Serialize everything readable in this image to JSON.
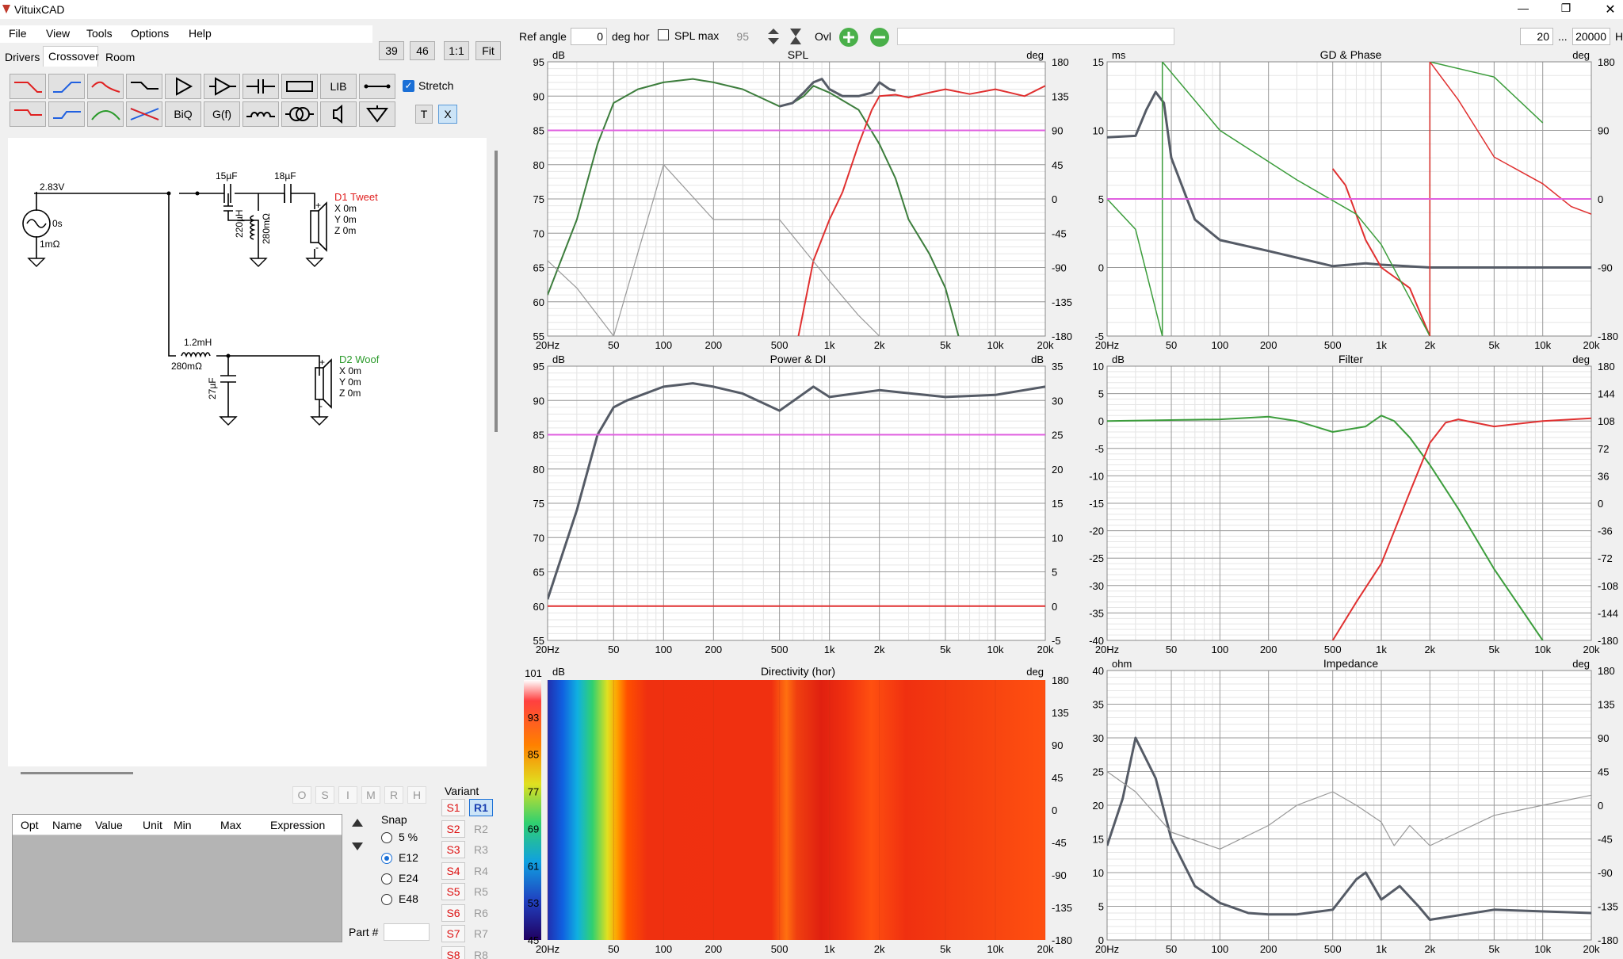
{
  "app": {
    "title": "VituixCAD",
    "win_min": "—",
    "win_max": "❐",
    "win_close": "✕"
  },
  "menu": [
    "File",
    "View",
    "Tools",
    "Options",
    "Help"
  ],
  "tabs": [
    "Drivers",
    "Crossover",
    "Room"
  ],
  "zoom": {
    "z39": "39",
    "z46": "46",
    "z11": "1:1",
    "fit": "Fit"
  },
  "toolbar": {
    "lib": "LIB",
    "biq": "BiQ",
    "gf": "G(f)",
    "stretch": "Stretch",
    "t": "T",
    "x": "X"
  },
  "top": {
    "ref_angle_label": "Ref angle",
    "ref_angle": "0",
    "deg_hor": "deg hor",
    "spl_max_label": "SPL max",
    "spl_max": "95",
    "ovl": "Ovl",
    "f_min": "20",
    "ellipsis": "...",
    "f_max": "20000",
    "h": "H"
  },
  "schematic": {
    "v": "2.83V",
    "s": "0s",
    "r": "1mΩ",
    "c1": "15µF",
    "c2": "18µF",
    "l1": "220µH",
    "r1": "280mΩ",
    "d1": "D1 Tweet",
    "d1x": "X 0m",
    "d1y": "Y 0m",
    "d1z": "Z 0m",
    "l2": "1.2mH",
    "r2": "280mΩ",
    "c3": "27µF",
    "d2": "D2 Woof",
    "d2x": "X 0m",
    "d2y": "Y 0m",
    "d2z": "Z 0m",
    "plus": "+",
    "minus": "-"
  },
  "opt": {
    "letters": [
      "O",
      "S",
      "I",
      "M",
      "R",
      "H"
    ],
    "columns": [
      "Opt",
      "Name",
      "Value",
      "Unit",
      "Min",
      "Max",
      "Expression"
    ]
  },
  "snap": {
    "label": "Snap",
    "options": [
      "5 %",
      "E12",
      "E24",
      "E48"
    ],
    "selected": "E12",
    "part_label": "Part #"
  },
  "variant": {
    "label": "Variant",
    "s": [
      "S1",
      "S2",
      "S3",
      "S4",
      "S5",
      "S6",
      "S7",
      "S8"
    ],
    "r": [
      "R1",
      "R2",
      "R3",
      "R4",
      "R5",
      "R6",
      "R7",
      "R8"
    ]
  },
  "freq_ticks": [
    "20Hz",
    "50",
    "100",
    "200",
    "500",
    "1k",
    "2k",
    "5k",
    "10k",
    "20k"
  ],
  "charts": {
    "spl": {
      "title": "SPL",
      "left_unit": "dB",
      "right_unit": "deg",
      "left": [
        "95",
        "90",
        "85",
        "80",
        "75",
        "70",
        "65",
        "60",
        "55"
      ],
      "right": [
        "180",
        "135",
        "90",
        "45",
        "0",
        "-45",
        "-90",
        "-135",
        "-180"
      ]
    },
    "gd": {
      "title": "GD & Phase",
      "left_unit": "ms",
      "right_unit": "deg",
      "left": [
        "15",
        "10",
        "5",
        "0",
        "-5"
      ],
      "right": [
        "180",
        "90",
        "0",
        "-90",
        "-180"
      ]
    },
    "power": {
      "title": "Power & DI",
      "left_unit": "dB",
      "right_unit": "dB",
      "left": [
        "95",
        "90",
        "85",
        "80",
        "75",
        "70",
        "65",
        "60",
        "55"
      ],
      "right": [
        "35",
        "30",
        "25",
        "20",
        "15",
        "10",
        "5",
        "0",
        "-5"
      ]
    },
    "filter": {
      "title": "Filter",
      "left_unit": "dB",
      "right_unit": "deg",
      "left": [
        "10",
        "5",
        "0",
        "-5",
        "-10",
        "-15",
        "-20",
        "-25",
        "-30",
        "-35",
        "-40"
      ],
      "right": [
        "180",
        "144",
        "108",
        "72",
        "36",
        "0",
        "-36",
        "-72",
        "-108",
        "-144",
        "-180"
      ]
    },
    "dir": {
      "title": "Directivity (hor)",
      "left_unit": "dB",
      "right_unit": "deg",
      "scale": [
        "101",
        "93",
        "85",
        "77",
        "69",
        "61",
        "53",
        "45"
      ],
      "right": [
        "180",
        "135",
        "90",
        "45",
        "0",
        "-45",
        "-90",
        "-135",
        "-180"
      ]
    },
    "imp": {
      "title": "Impedance",
      "left_unit": "ohm",
      "right_unit": "deg",
      "left": [
        "40",
        "35",
        "30",
        "25",
        "20",
        "15",
        "10",
        "5",
        "0"
      ],
      "right": [
        "180",
        "135",
        "90",
        "45",
        "0",
        "-45",
        "-90",
        "-135",
        "-180"
      ]
    }
  },
  "chart_data": [
    {
      "type": "line",
      "title": "SPL",
      "x_scale": "log",
      "xlim": [
        20,
        20000
      ],
      "ylim": [
        55,
        95
      ],
      "y2lim": [
        -180,
        180
      ],
      "series": [
        {
          "color": "#3c7d3c",
          "x": [
            20,
            30,
            40,
            50,
            70,
            100,
            150,
            200,
            300,
            500,
            600,
            700,
            800,
            1000,
            1500,
            2000,
            2500,
            3000,
            4000,
            5000,
            6000
          ],
          "y": [
            61,
            72,
            83,
            89,
            91,
            92,
            92.5,
            92,
            91,
            88.5,
            89,
            90,
            91.5,
            90.5,
            88,
            83,
            78,
            72,
            67,
            62,
            55
          ]
        },
        {
          "color": "#555b66",
          "x": [
            500,
            600,
            700,
            800,
            900,
            1000,
            1200,
            1500,
            1800,
            2000,
            2300,
            2500
          ],
          "y": [
            88.5,
            89,
            90.5,
            92,
            92.5,
            91,
            90,
            90,
            90.5,
            92,
            91,
            90.8
          ]
        },
        {
          "color": "#e03030",
          "x": [
            650,
            800,
            1000,
            1200,
            1500,
            1800,
            2000,
            2500,
            3000,
            4000,
            5000,
            7000,
            10000,
            15000,
            20000
          ],
          "y": [
            55,
            66,
            72,
            76,
            83,
            88,
            90,
            90.2,
            89.8,
            90.5,
            91,
            90.3,
            91,
            90,
            91.5
          ]
        },
        {
          "color": "#999999",
          "x": [
            20,
            30,
            50,
            100,
            200,
            500,
            1000,
            1500,
            2000
          ],
          "y": [
            66,
            62,
            55,
            80,
            72,
            72,
            63,
            58,
            55
          ]
        },
        {
          "color": "#e060e0",
          "x": [
            20,
            20000
          ],
          "y": [
            85,
            85
          ]
        }
      ]
    },
    {
      "type": "line",
      "title": "GD & Phase",
      "x_scale": "log",
      "xlim": [
        20,
        20000
      ],
      "ylim": [
        -5,
        15
      ],
      "y2lim": [
        -180,
        180
      ],
      "series": [
        {
          "color": "#555b66",
          "x": [
            20,
            30,
            35,
            40,
            45,
            50,
            70,
            100,
            200,
            500,
            800,
            1000,
            2000,
            20000
          ],
          "y": [
            9.5,
            9.6,
            11.5,
            12.8,
            12,
            8,
            3.5,
            2,
            1.2,
            0.1,
            0.3,
            0.2,
            0,
            0
          ]
        },
        {
          "color": "#e03030",
          "x": [
            500,
            600,
            800,
            1000,
            1500,
            2000
          ],
          "y": [
            7.2,
            6,
            2,
            0,
            -1.5,
            -5
          ]
        }
      ]
    },
    {
      "type": "line",
      "title": "Power & DI",
      "x_scale": "log",
      "xlim": [
        20,
        20000
      ],
      "ylim": [
        55,
        95
      ],
      "y2lim": [
        -5,
        35
      ],
      "series": [
        {
          "color": "#555b66",
          "x": [
            20,
            30,
            40,
            50,
            60,
            100,
            150,
            200,
            300,
            500,
            800,
            1000,
            2000,
            5000,
            10000,
            20000
          ],
          "y": [
            61,
            74,
            85,
            89,
            90,
            92,
            92.5,
            92,
            91,
            88.5,
            92,
            90.5,
            91.5,
            90.5,
            90.8,
            92
          ]
        },
        {
          "color": "#e060e0",
          "x": [
            20,
            20000
          ],
          "y": [
            85,
            85
          ]
        },
        {
          "color": "#e03030",
          "x": [
            20,
            20000
          ],
          "y": [
            60,
            60
          ]
        }
      ]
    },
    {
      "type": "line",
      "title": "Filter",
      "x_scale": "log",
      "xlim": [
        20,
        20000
      ],
      "ylim": [
        -40,
        10
      ],
      "series": [
        {
          "color": "#3c9d3c",
          "x": [
            20,
            100,
            200,
            300,
            500,
            800,
            1000,
            1200,
            1500,
            2000,
            3000,
            5000,
            10000
          ],
          "y": [
            0,
            0.3,
            0.8,
            0,
            -2,
            -1,
            1,
            0,
            -3,
            -8,
            -16,
            -27,
            -40
          ]
        },
        {
          "color": "#e03030",
          "x": [
            500,
            700,
            1000,
            1500,
            2000,
            2500,
            3000,
            5000,
            10000,
            20000
          ],
          "y": [
            -40,
            -33,
            -26,
            -13,
            -4,
            -0.3,
            0.3,
            -1,
            0,
            0.5
          ]
        }
      ]
    },
    {
      "type": "heatmap",
      "title": "Directivity (hor)",
      "x_scale": "log",
      "xlim": [
        20,
        20000
      ],
      "zlim": [
        45,
        101
      ]
    },
    {
      "type": "line",
      "title": "Impedance",
      "x_scale": "log",
      "xlim": [
        20,
        20000
      ],
      "ylim": [
        0,
        40
      ],
      "series": [
        {
          "color": "#555b66",
          "x": [
            20,
            25,
            30,
            40,
            50,
            70,
            100,
            150,
            200,
            300,
            500,
            700,
            800,
            1000,
            1300,
            1700,
            2000,
            5000,
            20000
          ],
          "y": [
            14,
            21,
            30,
            24,
            15,
            8,
            5.5,
            4,
            3.8,
            3.8,
            4.5,
            9,
            10,
            6,
            8,
            5,
            3,
            4.5,
            4
          ]
        },
        {
          "color": "#999999",
          "x": [
            20,
            30,
            50,
            100,
            200,
            300,
            500,
            700,
            1000,
            1200,
            1500,
            2000,
            5000,
            10000,
            20000
          ],
          "y": [
            25,
            22,
            16,
            13.5,
            17,
            20,
            22,
            20,
            17.5,
            14,
            17,
            14,
            18.5,
            20,
            21.5
          ]
        }
      ]
    }
  ]
}
